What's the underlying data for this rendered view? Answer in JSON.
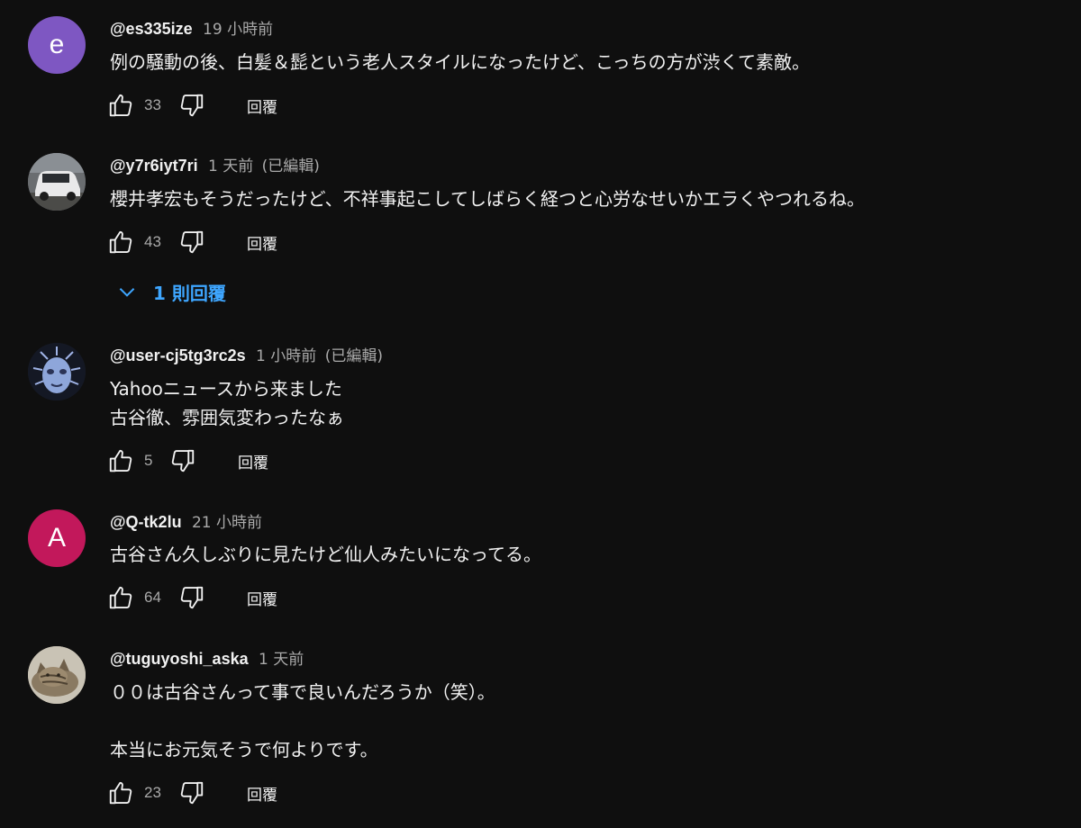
{
  "comments": [
    {
      "avatar": {
        "letter": "e",
        "bg": "#7e57c2"
      },
      "handle": "@es335ize",
      "time": "19 小時前",
      "edited": "",
      "lines": [
        "例の騒動の後、白髪＆髭という老人スタイルになったけど、こっちの方が渋くて素敵。"
      ],
      "likes": "33",
      "reply_label": "回覆"
    },
    {
      "avatar": {
        "icon": "car-photo-avatar"
      },
      "handle": "@y7r6iyt7ri",
      "time": "1 天前",
      "edited": "(已編輯)",
      "lines": [
        "櫻井孝宏もそうだったけど、不祥事起こしてしばらく経つと心労なせいかエラくやつれるね。"
      ],
      "likes": "43",
      "reply_label": "回覆",
      "replies_toggle": "1 則回覆"
    },
    {
      "avatar": {
        "icon": "blue-mask-avatar"
      },
      "handle": "@user-cj5tg3rc2s",
      "time": "1 小時前",
      "edited": "(已編輯)",
      "lines": [
        "Yahooニュースから来ました",
        "古谷徹、雰囲気変わったなぁ"
      ],
      "likes": "5",
      "reply_label": "回覆"
    },
    {
      "avatar": {
        "letter": "A",
        "bg": "#c2185b"
      },
      "handle": "@Q-tk2lu",
      "time": "21 小時前",
      "edited": "",
      "lines": [
        "古谷さん久しぶりに見たけど仙人みたいになってる。"
      ],
      "likes": "64",
      "reply_label": "回覆"
    },
    {
      "avatar": {
        "icon": "cat-photo-avatar"
      },
      "handle": "@tuguyoshi_aska",
      "time": "1 天前",
      "edited": "",
      "lines": [
        "００は古谷さんって事で良いんだろうか（笑）。",
        "",
        "本当にお元気そうで何よりです。"
      ],
      "likes": "23",
      "reply_label": "回覆"
    }
  ],
  "icons": {
    "like": "thumb-up-icon",
    "dislike": "thumb-down-icon",
    "expand": "chevron-down-icon"
  },
  "colors": {
    "background": "#0f0f0f",
    "text": "#f1f1f1",
    "secondary": "#aaaaaa",
    "link": "#3ea6ff"
  }
}
